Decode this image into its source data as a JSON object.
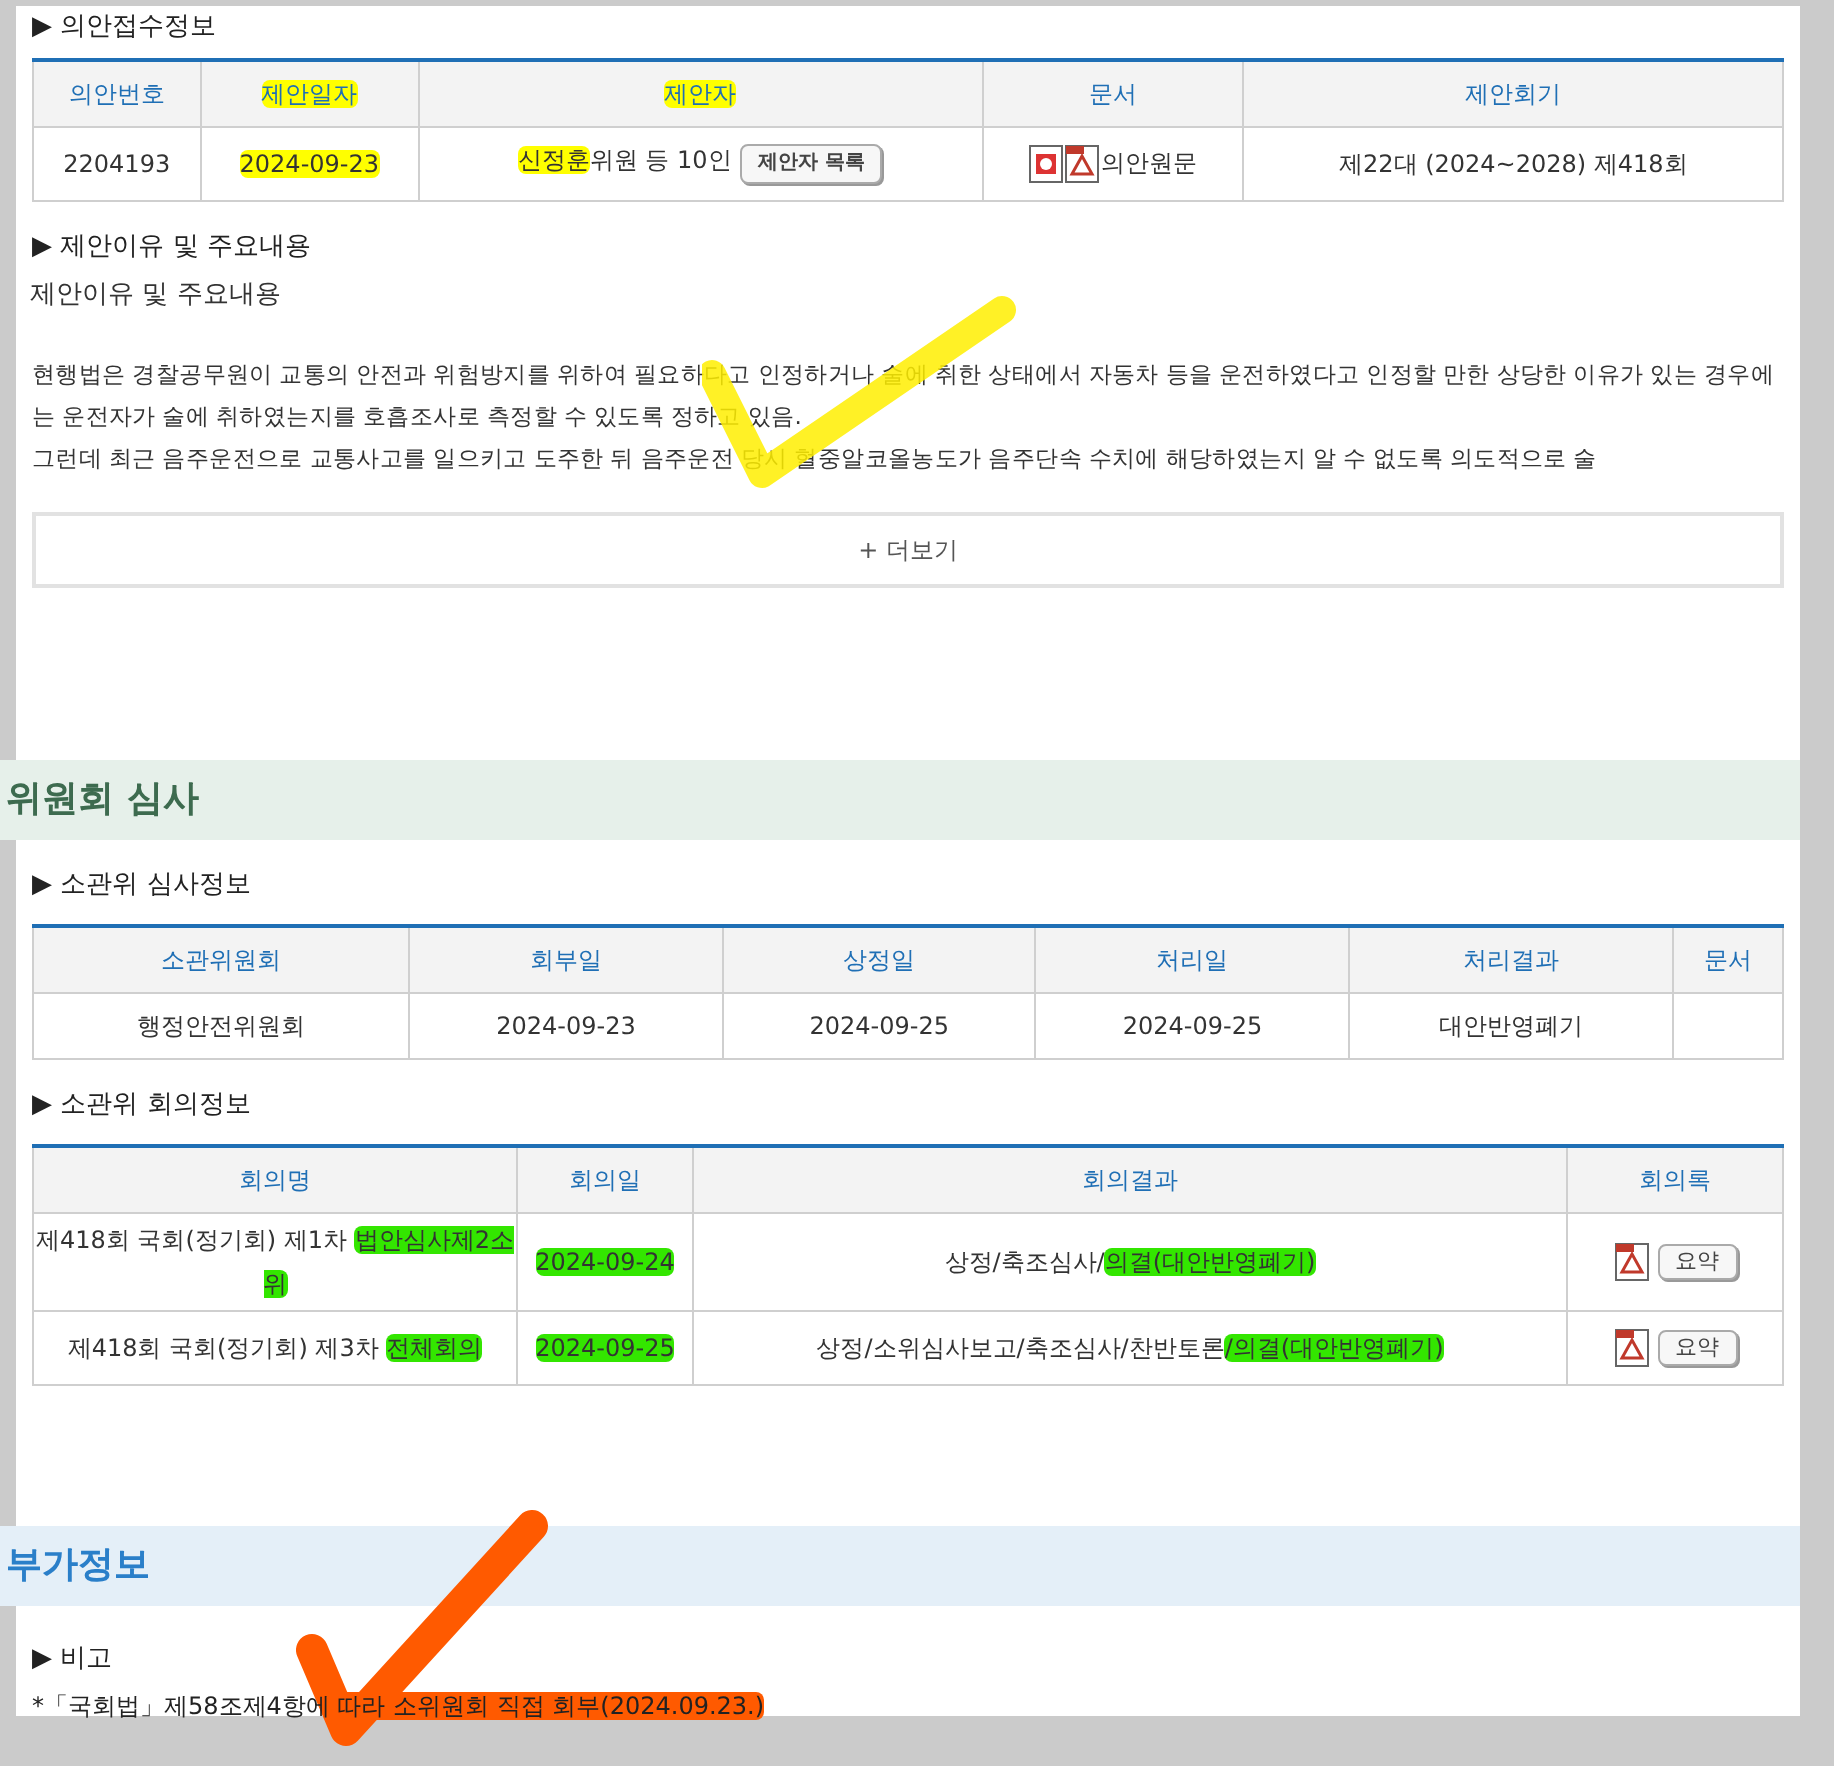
{
  "receipt": {
    "heading": "▶ 의안접수정보",
    "columns": [
      [
        {
          "text": "의안번호"
        }
      ],
      [
        {
          "text": "제안일자",
          "color": "#ffff00"
        }
      ],
      [
        {
          "text": "제안자",
          "color": "#ffff00"
        }
      ],
      [
        {
          "text": "문서"
        }
      ],
      [
        {
          "text": "제안회기"
        }
      ]
    ],
    "row": {
      "number": [
        {
          "text": "2204193"
        }
      ],
      "date": [
        {
          "text": "2024-09-23",
          "color": "#ffff00"
        }
      ],
      "proposer": [
        {
          "text": "신정훈",
          "color": "#ffff00"
        },
        {
          "text": "위원 등 10인"
        }
      ],
      "proposer_button": "제안자 목록",
      "document": [
        {
          "text": "의안원문"
        }
      ],
      "session": [
        {
          "text": "제22대 (2024~2028) 제418회"
        }
      ]
    }
  },
  "reason": {
    "heading": "▶ 제안이유 및 주요내용",
    "title": "제안이유 및 주요내용",
    "paragraphs": [
      "현행법은 경찰공무원이 교통의 안전과 위험방지를 위하여 필요하다고 인정하거나 술에 취한 상태에서 자동차 등을 운전하였다고 인정할 만한 상당한 이유가 있는 경우에는 운전자가 술에 취하였는지를 호흡조사로 측정할 수 있도록 정하고 있음.",
      "그런데 최근 음주운전으로 교통사고를 일으키고 도주한 뒤 음주운전 당시 혈중알코올농도가 음주단속 수치에 해당하였는지 알 수 없도록 의도적으로 술"
    ],
    "more_button": "+ 더보기"
  },
  "committee": {
    "title": "위원회 심사",
    "review": {
      "heading": "▶ 소관위 심사정보",
      "columns": [
        "소관위원회",
        "회부일",
        "상정일",
        "처리일",
        "처리결과",
        "문서"
      ],
      "row": [
        "행정안전위원회",
        "2024-09-23",
        "2024-09-25",
        "2024-09-25",
        "대안반영폐기"
      ]
    },
    "meetings": {
      "heading": "▶ 소관위 회의정보",
      "columns": [
        "회의명",
        "회의일",
        "회의결과",
        "회의록"
      ],
      "rows": [
        {
          "name": [
            {
              "text": "제418회 국회(정기회) 제1차 "
            },
            {
              "text": "법안심사제2소위",
              "color": "#33e600"
            }
          ],
          "date": [
            {
              "text": "2024-09-24",
              "color": "#33e600"
            }
          ],
          "result": [
            {
              "text": "상정/축조심사/"
            },
            {
              "text": "의결(대안반영폐기)",
              "color": "#33e600"
            }
          ],
          "summary_button": "요약"
        },
        {
          "name": [
            {
              "text": "제418회 국회(정기회) 제3차 "
            },
            {
              "text": "전체회의",
              "color": "#33e600"
            }
          ],
          "date": [
            {
              "text": "2024-09-25",
              "color": "#33e600"
            }
          ],
          "result": [
            {
              "text": "상정/소위심사보고/축조심사/찬반토론"
            },
            {
              "text": "/의결(대안반영폐기)",
              "color": "#33e600"
            }
          ],
          "summary_button": "요약"
        }
      ]
    }
  },
  "extra": {
    "title": "부가정보",
    "heading": "▶ 비고",
    "note": [
      {
        "text": "*「국회법」제58조제4항에 "
      },
      {
        "text": "따라 소위원회 직접 회부(2024.09.23.)",
        "color": "#ff5a00"
      }
    ]
  }
}
